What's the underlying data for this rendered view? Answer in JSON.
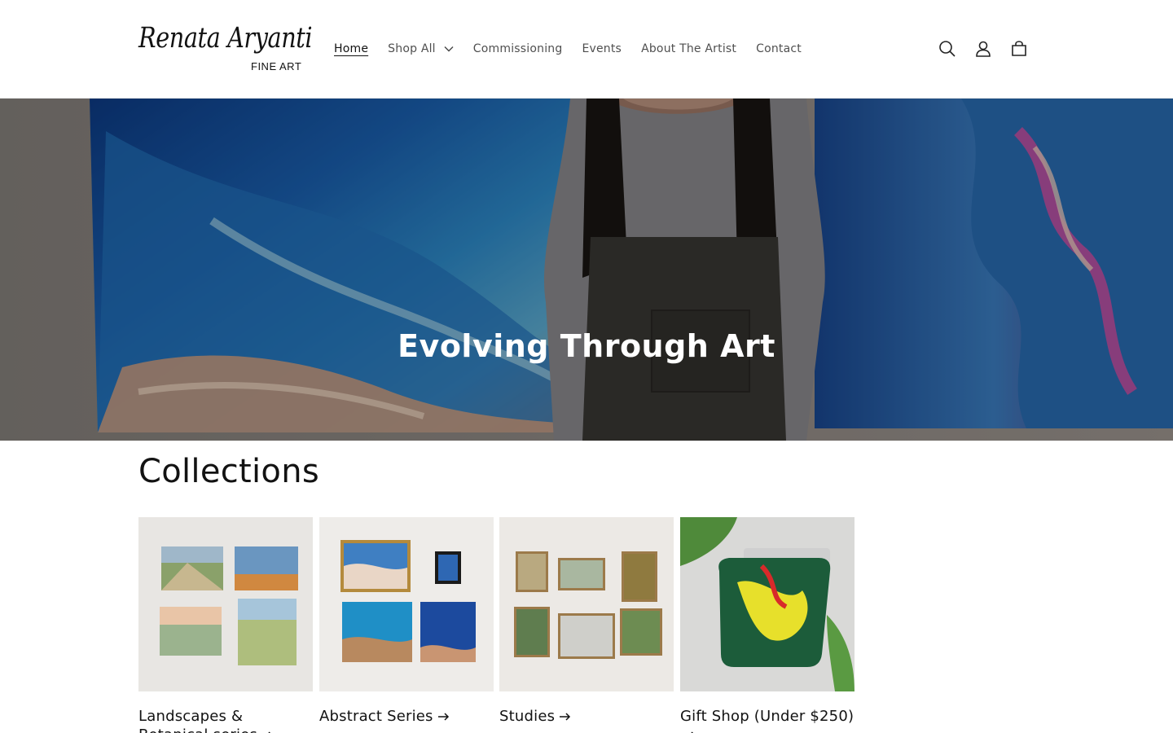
{
  "brand": {
    "logo_script": "Renata Aryanti",
    "logo_sub": "FINE ART"
  },
  "nav": {
    "items": [
      {
        "label": "Home",
        "active": true
      },
      {
        "label": "Shop All",
        "has_dropdown": true
      },
      {
        "label": "Commissioning"
      },
      {
        "label": "Events"
      },
      {
        "label": "About The Artist"
      },
      {
        "label": "Contact"
      }
    ]
  },
  "header_icons": [
    "search-icon",
    "account-icon",
    "cart-icon"
  ],
  "hero": {
    "title": "Evolving Through Art"
  },
  "collections": {
    "title": "Collections",
    "items": [
      {
        "label": "Landscapes & Botanical series"
      },
      {
        "label": "Abstract Series"
      },
      {
        "label": "Studies"
      },
      {
        "label": "Gift Shop (Under $250)"
      }
    ]
  },
  "colors": {
    "text": "#121212",
    "background": "#ffffff",
    "hero_overlay": "#000000"
  }
}
